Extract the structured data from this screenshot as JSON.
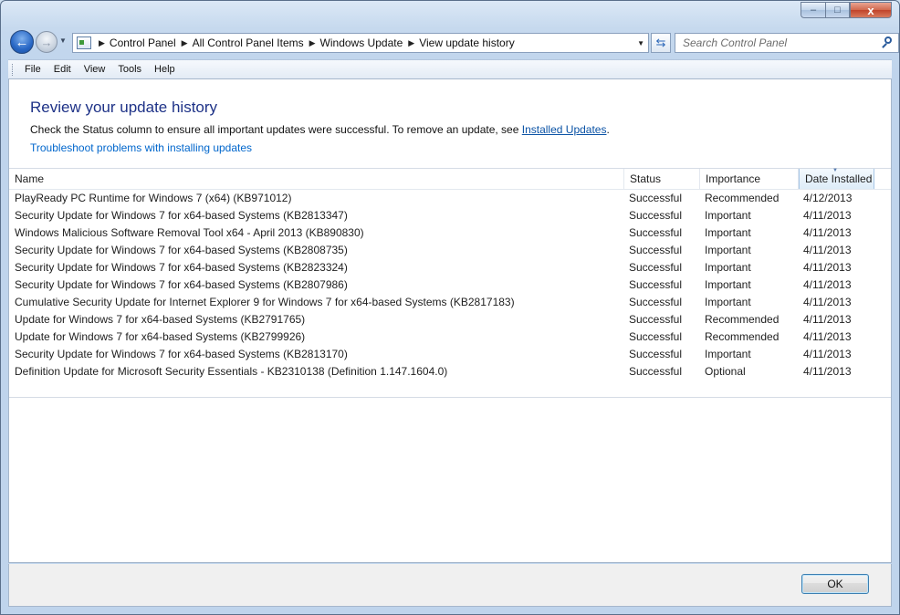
{
  "window": {
    "caption": {
      "minimize": "–",
      "maximize": "□",
      "close": "x"
    }
  },
  "nav": {
    "back": "←",
    "forward": "→",
    "breadcrumbs": [
      "Control Panel",
      "All Control Panel Items",
      "Windows Update",
      "View update history"
    ],
    "search_placeholder": "Search Control Panel"
  },
  "menu": [
    "File",
    "Edit",
    "View",
    "Tools",
    "Help"
  ],
  "page": {
    "title": "Review your update history",
    "description_before_link": "Check the Status column to ensure all important updates were successful. To remove an update, see ",
    "description_link": "Installed Updates",
    "description_after_link": ".",
    "troubleshoot_link": "Troubleshoot problems with installing updates"
  },
  "table": {
    "columns": [
      "Name",
      "Status",
      "Importance",
      "Date Installed"
    ],
    "sorted_column": "Date Installed",
    "rows": [
      {
        "name": "PlayReady PC Runtime for Windows 7 (x64) (KB971012)",
        "status": "Successful",
        "importance": "Recommended",
        "date": "4/12/2013"
      },
      {
        "name": "Security Update for Windows 7 for x64-based Systems (KB2813347)",
        "status": "Successful",
        "importance": "Important",
        "date": "4/11/2013"
      },
      {
        "name": "Windows Malicious Software Removal Tool x64 - April 2013 (KB890830)",
        "status": "Successful",
        "importance": "Important",
        "date": "4/11/2013"
      },
      {
        "name": "Security Update for Windows 7 for x64-based Systems (KB2808735)",
        "status": "Successful",
        "importance": "Important",
        "date": "4/11/2013"
      },
      {
        "name": "Security Update for Windows 7 for x64-based Systems (KB2823324)",
        "status": "Successful",
        "importance": "Important",
        "date": "4/11/2013"
      },
      {
        "name": "Security Update for Windows 7 for x64-based Systems (KB2807986)",
        "status": "Successful",
        "importance": "Important",
        "date": "4/11/2013"
      },
      {
        "name": "Cumulative Security Update for Internet Explorer 9 for Windows 7 for x64-based Systems (KB2817183)",
        "status": "Successful",
        "importance": "Important",
        "date": "4/11/2013"
      },
      {
        "name": "Update for Windows 7 for x64-based Systems (KB2791765)",
        "status": "Successful",
        "importance": "Recommended",
        "date": "4/11/2013"
      },
      {
        "name": "Update for Windows 7 for x64-based Systems (KB2799926)",
        "status": "Successful",
        "importance": "Recommended",
        "date": "4/11/2013"
      },
      {
        "name": "Security Update for Windows 7 for x64-based Systems (KB2813170)",
        "status": "Successful",
        "importance": "Important",
        "date": "4/11/2013"
      },
      {
        "name": "Definition Update for Microsoft Security Essentials - KB2310138 (Definition 1.147.1604.0)",
        "status": "Successful",
        "importance": "Optional",
        "date": "4/11/2013"
      }
    ]
  },
  "footer": {
    "ok_label": "OK"
  }
}
